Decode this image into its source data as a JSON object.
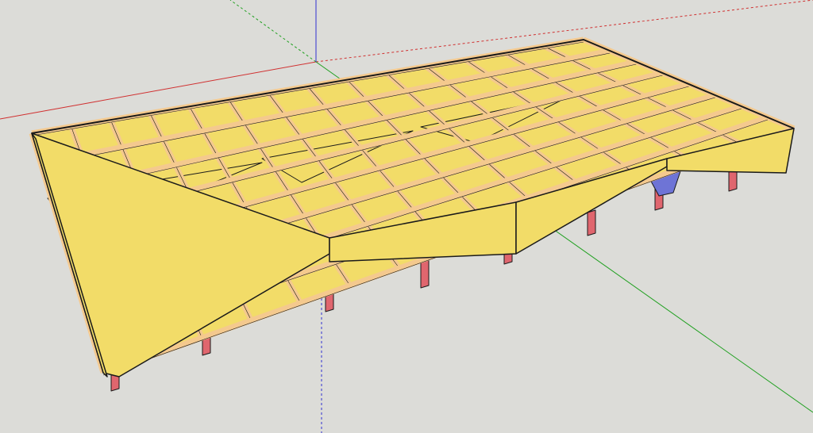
{
  "viewport": {
    "background": "#dcdcd8",
    "model": "3d-deck-framing-model"
  },
  "axes": {
    "red_axis_color": "#d03030",
    "green_axis_color": "#20a020",
    "blue_axis_color": "#3030d0"
  },
  "model_colors": {
    "panel_face": "#f2dc68",
    "joist": "#f4c98e",
    "post": "#e0666e",
    "brace": "#6e74d6",
    "edge": "#1a1a1a"
  }
}
